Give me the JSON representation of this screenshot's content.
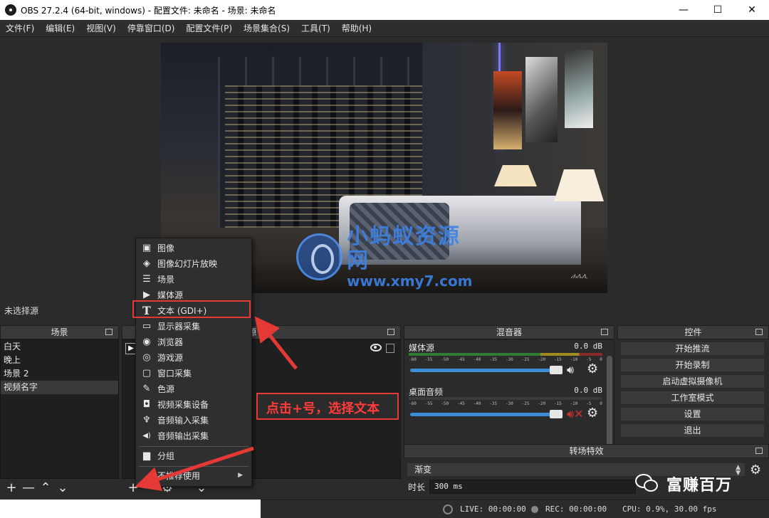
{
  "window": {
    "title": "OBS 27.2.4 (64-bit, windows) - 配置文件: 未命名 - 场景: 未命名",
    "minimize": "—",
    "maximize": "☐",
    "close": "✕"
  },
  "menubar": [
    "文件(F)",
    "编辑(E)",
    "视图(V)",
    "停靠窗口(D)",
    "配置文件(P)",
    "场景集合(S)",
    "工具(T)",
    "帮助(H)"
  ],
  "watermark": {
    "cn": "小蚂蚁资源网",
    "url": "www.xmy7.com"
  },
  "preview": {
    "signature": "ሐሌሊ"
  },
  "selection_status": "未选择源",
  "scenes": {
    "title": "场景",
    "items": [
      "白天",
      "晚上",
      "场景 2",
      "视频名字"
    ],
    "selected_index": 3,
    "toolbar": [
      "+",
      "—",
      "⌃",
      "⌄"
    ]
  },
  "sources": {
    "title_fragment": "源",
    "toolbar": [
      "+",
      "—",
      "⚙",
      "⌃",
      "⌄"
    ]
  },
  "mixer": {
    "title": "混音器",
    "ticks": [
      "-60",
      "-55",
      "-50",
      "-45",
      "-40",
      "-35",
      "-30",
      "-25",
      "-20",
      "-15",
      "-10",
      "-5",
      "0"
    ],
    "channels": [
      {
        "name": "媒体源",
        "db": "0.0 dB",
        "volume_fraction": 1.0,
        "muted": false
      },
      {
        "name": "桌面音频",
        "db": "0.0 dB",
        "volume_fraction": 1.0,
        "muted": true
      }
    ]
  },
  "controls": {
    "title": "控件",
    "buttons": [
      "开始推流",
      "开始录制",
      "启动虚拟摄像机",
      "工作室模式",
      "设置",
      "退出"
    ]
  },
  "transitions": {
    "title": "转场特效",
    "selected": "渐变",
    "duration_label": "时长",
    "duration_value": "300 ms"
  },
  "statusbar": {
    "live": "LIVE: 00:00:00",
    "rec": "REC: 00:00:00",
    "cpu": "CPU: 0.9%, 30.00 fps"
  },
  "context_menu": {
    "items": [
      {
        "label": "图像",
        "icon": "image-icon"
      },
      {
        "label": "图像幻灯片放映",
        "icon": "slideshow-icon"
      },
      {
        "label": "场景",
        "icon": "list-icon"
      },
      {
        "label": "媒体源",
        "icon": "play-icon"
      },
      {
        "label": "文本 (GDI+)",
        "icon": "text-icon"
      },
      {
        "label": "显示器采集",
        "icon": "monitor-icon"
      },
      {
        "label": "浏览器",
        "icon": "globe-icon"
      },
      {
        "label": "游戏源",
        "icon": "gamepad-icon"
      },
      {
        "label": "窗口采集",
        "icon": "window-icon"
      },
      {
        "label": "色源",
        "icon": "brush-icon"
      },
      {
        "label": "视频采集设备",
        "icon": "camera-icon"
      },
      {
        "label": "音频输入采集",
        "icon": "microphone-icon"
      },
      {
        "label": "音频输出采集",
        "icon": "speaker-icon"
      },
      {
        "label": "分组",
        "icon": "folder-icon"
      },
      {
        "label": "不推荐使用",
        "icon": ""
      }
    ],
    "highlighted": "文本 (GDI+)",
    "icon_glyphs": [
      "▣",
      "◈",
      "☰",
      "▶",
      "T",
      "▭",
      "◉",
      "◎",
      "▢",
      "✎",
      "◘",
      "♆",
      "◀)",
      "▆",
      ""
    ]
  },
  "annotation": {
    "text": "点击+号，选择文本",
    "color": "#e53935"
  },
  "wechat": {
    "text": "富赚百万"
  }
}
